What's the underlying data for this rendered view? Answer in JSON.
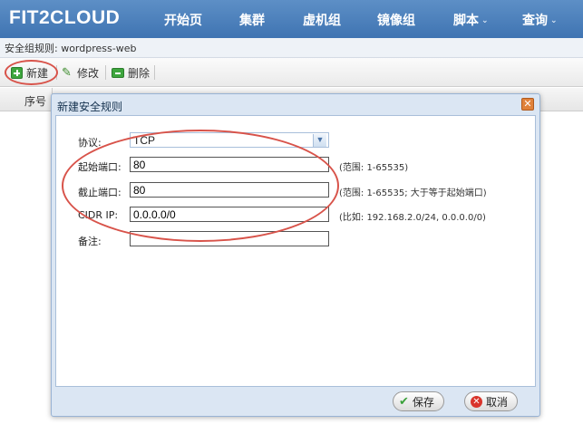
{
  "app": {
    "logo": "FIT2CLOUD"
  },
  "nav": {
    "items": [
      {
        "label": "开始页"
      },
      {
        "label": "集群"
      },
      {
        "label": "虚机组"
      },
      {
        "label": "镜像组"
      },
      {
        "label": "脚本",
        "caret": "⌄"
      },
      {
        "label": "查询",
        "caret": "⌄"
      }
    ]
  },
  "page": {
    "subtitle": "安全组规则: wordpress-web"
  },
  "toolbar": {
    "new_label": "新建",
    "edit_label": "修改",
    "delete_label": "删除"
  },
  "table": {
    "col_seq": "序号"
  },
  "dialog": {
    "title": "新建安全规则",
    "close_glyph": "✕",
    "protocol": {
      "label": "协议:",
      "value": "TCP"
    },
    "start_port": {
      "label": "起始端口:",
      "value": "80",
      "hint": "(范围: 1-65535)"
    },
    "end_port": {
      "label": "截止端口:",
      "value": "80",
      "hint": "(范围: 1-65535; 大于等于起始端口)"
    },
    "cidr": {
      "label": "CIDR IP:",
      "value": "0.0.0.0/0",
      "hint": "(比如:   192.168.2.0/24, 0.0.0.0/0)"
    },
    "note": {
      "label": "备注:",
      "value": ""
    },
    "save_label": "保存",
    "cancel_label": "取消"
  },
  "colors": {
    "nav_bg": "#4a7fbd",
    "annotation": "#d8534a",
    "dialog_bg": "#dbe6f3"
  }
}
